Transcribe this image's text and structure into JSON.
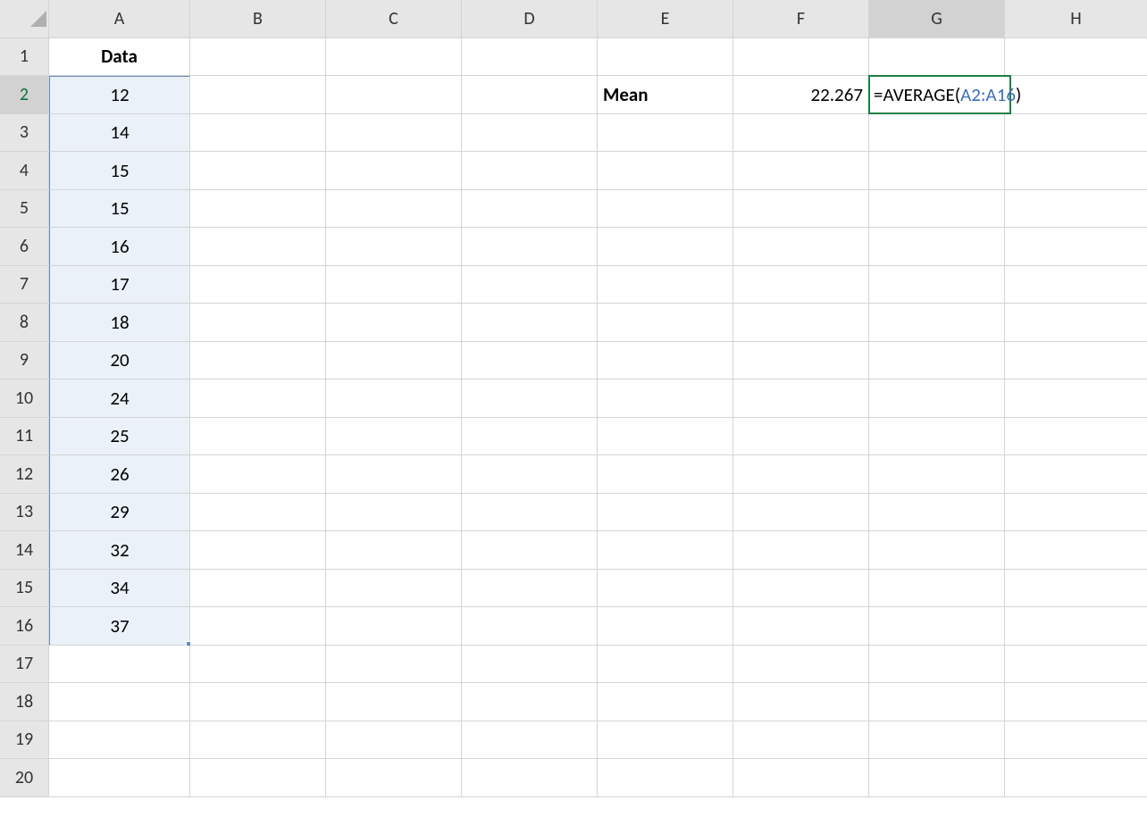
{
  "headers": {
    "cols": [
      "A",
      "B",
      "C",
      "D",
      "E",
      "F",
      "G",
      "H"
    ],
    "rows": [
      "1",
      "2",
      "3",
      "4",
      "5",
      "6",
      "7",
      "8",
      "9",
      "10",
      "11",
      "12",
      "13",
      "14",
      "15",
      "16",
      "17",
      "18",
      "19",
      "20"
    ]
  },
  "columnA": {
    "title": "Data",
    "values": [
      "12",
      "14",
      "15",
      "15",
      "16",
      "17",
      "18",
      "20",
      "24",
      "25",
      "26",
      "29",
      "32",
      "34",
      "37"
    ]
  },
  "labels": {
    "mean": "Mean"
  },
  "values": {
    "mean_result": "22.267"
  },
  "formula": {
    "prefix": "=AVERAGE(",
    "ref": "A2:A16",
    "suffix": ")"
  },
  "corner_triangle_color": "#b0b0b0"
}
